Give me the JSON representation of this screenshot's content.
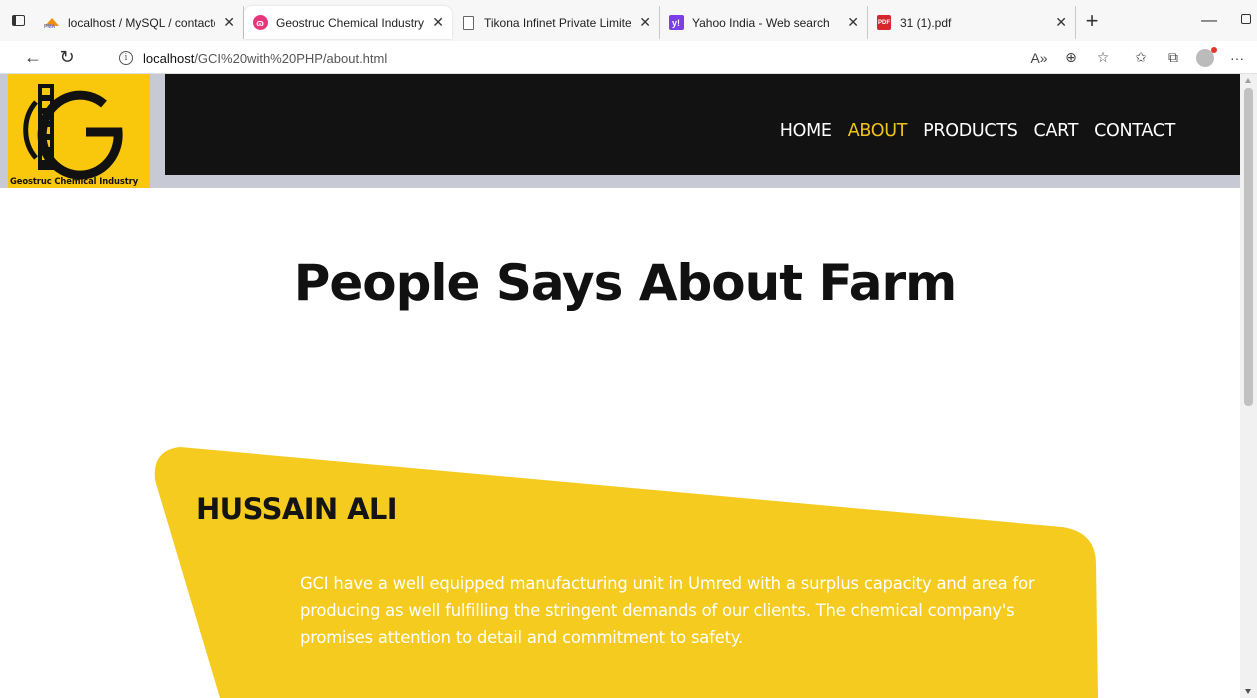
{
  "browser": {
    "tabs": [
      {
        "title": "localhost / MySQL / contactdi",
        "icon": "phpmyadmin-icon"
      },
      {
        "title": "Geostruc Chemical Industry",
        "icon": "gci-icon"
      },
      {
        "title": "Tikona Infinet Private Limited",
        "icon": "document-icon"
      },
      {
        "title": "Yahoo India - Web search",
        "icon": "yahoo-icon"
      },
      {
        "title": "31 (1).pdf",
        "icon": "pdf-icon"
      }
    ],
    "active_tab": 1,
    "url": {
      "host": "localhost",
      "path": "/GCI%20with%20PHP/about.html"
    }
  },
  "site": {
    "logo_text": "Geostruc Chemical Industry",
    "logo_mark": "G",
    "nav": [
      {
        "label": "HOME"
      },
      {
        "label": "ABOUT"
      },
      {
        "label": "PRODUCTS"
      },
      {
        "label": "CART"
      },
      {
        "label": "CONTACT"
      }
    ],
    "active_nav": "ABOUT"
  },
  "page": {
    "heading": "People Says About Farm",
    "testimonial": {
      "name": "HUSSAIN ALI",
      "text": "GCI have a well equipped manufacturing unit in Umred with a surplus capacity and area for producing as well fulfilling the stringent demands of our clients. The chemical company's promises attention to detail and commitment to safety."
    }
  },
  "colors": {
    "accent": "#f0c419",
    "card": "#f5cb1f",
    "navbar": "#121212",
    "header_strip": "#c7cad4"
  }
}
